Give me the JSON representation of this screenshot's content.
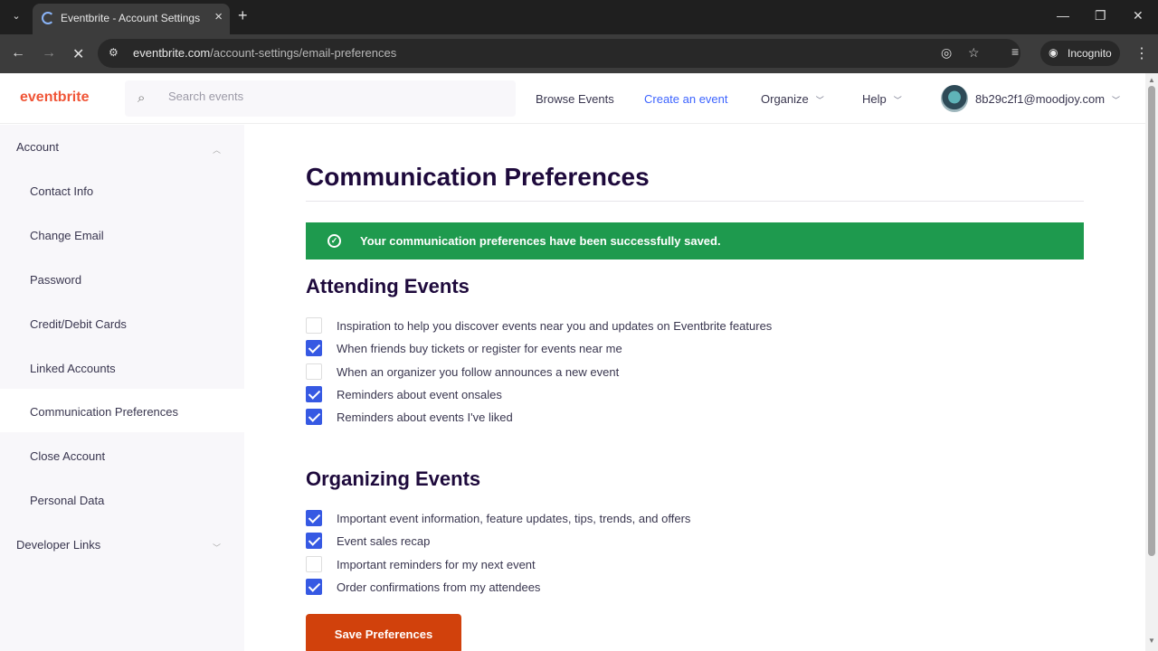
{
  "browser": {
    "tab_title": "Eventbrite - Account Settings",
    "url_domain": "eventbrite.com",
    "url_path": "/account-settings/email-preferences",
    "incognito_label": "Incognito"
  },
  "header": {
    "logo": "eventbrite",
    "search_placeholder": "Search events",
    "nav": {
      "browse": "Browse Events",
      "create": "Create an event",
      "organize": "Organize",
      "help": "Help"
    },
    "user_email": "8b29c2f1@moodjoy.com"
  },
  "sidebar": {
    "account_header": "Account",
    "items": [
      "Contact Info",
      "Change Email",
      "Password",
      "Credit/Debit Cards",
      "Linked Accounts",
      "Communication Preferences",
      "Close Account",
      "Personal Data"
    ],
    "active_index": 5,
    "developer_header": "Developer Links"
  },
  "main": {
    "title": "Communication Preferences",
    "alert": "Your communication preferences have been successfully saved.",
    "attending": {
      "title": "Attending Events",
      "prefs": [
        {
          "label": "Inspiration to help you discover events near you and updates on Eventbrite features",
          "checked": false
        },
        {
          "label": "When friends buy tickets or register for events near me",
          "checked": true
        },
        {
          "label": "When an organizer you follow announces a new event",
          "checked": false
        },
        {
          "label": "Reminders about event onsales",
          "checked": true
        },
        {
          "label": "Reminders about events I've liked",
          "checked": true
        }
      ]
    },
    "organizing": {
      "title": "Organizing Events",
      "prefs": [
        {
          "label": "Important event information, feature updates, tips, trends, and offers",
          "checked": true
        },
        {
          "label": "Event sales recap",
          "checked": true
        },
        {
          "label": "Important reminders for my next event",
          "checked": false
        },
        {
          "label": "Order confirmations from my attendees",
          "checked": true
        }
      ]
    },
    "save_label": "Save Preferences"
  },
  "colors": {
    "brand": "#f05537",
    "success": "#1e9a4e",
    "checkbox": "#3659e3",
    "save_button": "#d1410c"
  }
}
